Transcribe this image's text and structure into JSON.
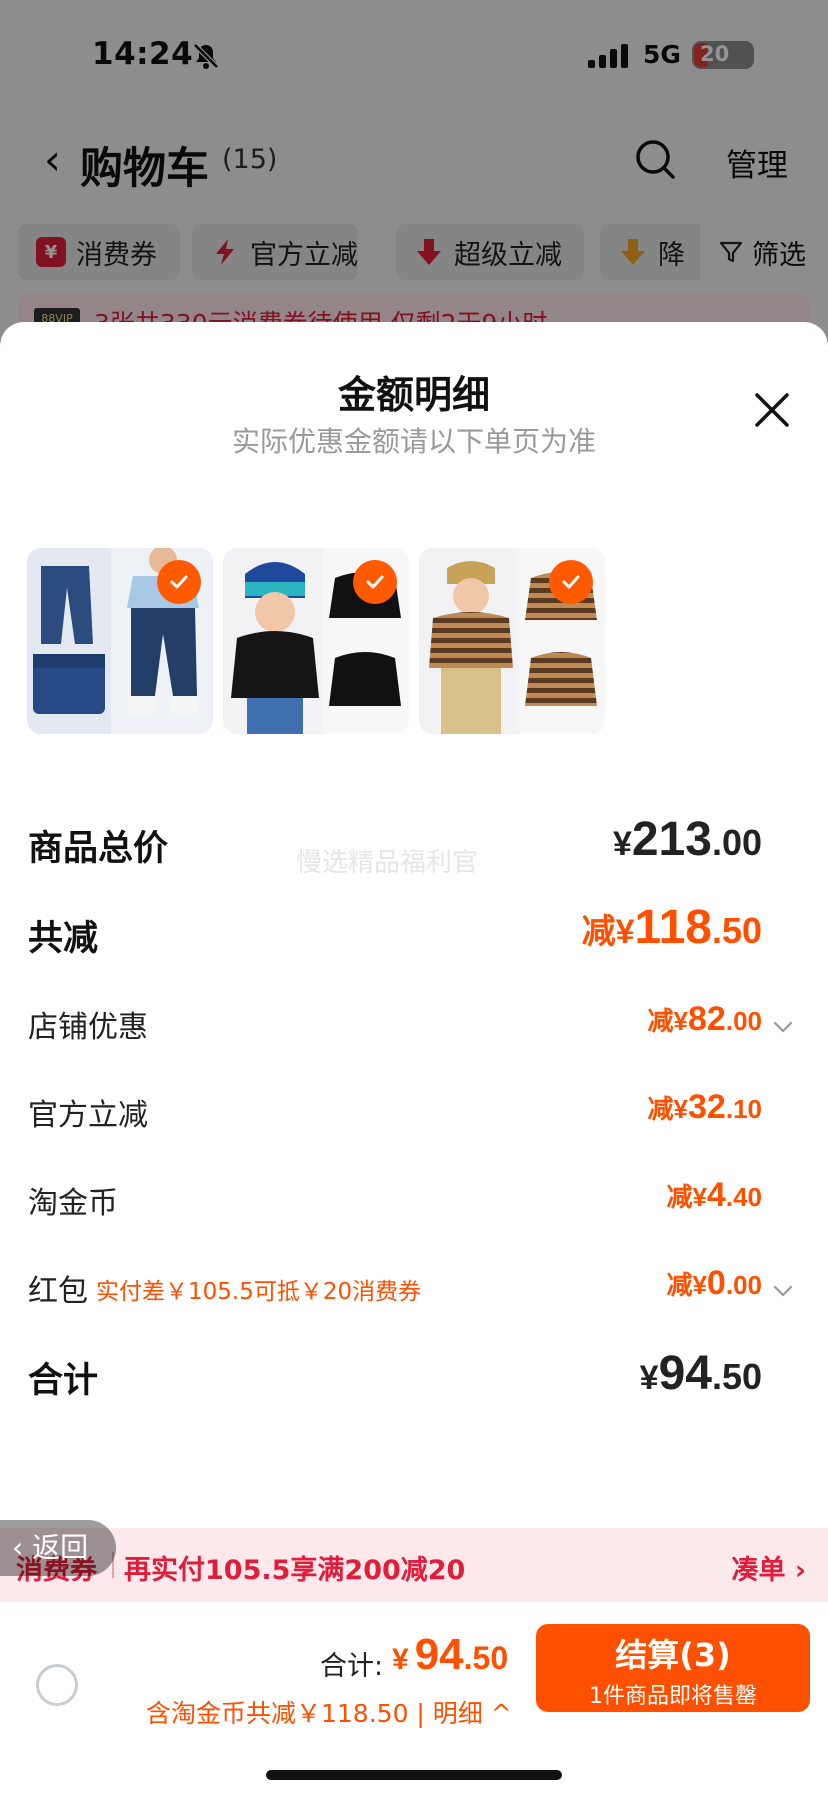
{
  "status_bar": {
    "time": "14:24",
    "network": "5G",
    "battery": "20"
  },
  "cart": {
    "title": "购物车",
    "count": "(15)",
    "manage": "管理"
  },
  "chips": [
    {
      "label": "消费券",
      "icon": "coupon-icon"
    },
    {
      "label": "官方立减",
      "icon": "lightning-icon"
    },
    {
      "label": "超级立减",
      "icon": "down-arrow-icon"
    },
    {
      "label": "降",
      "icon": "price-drop-icon"
    }
  ],
  "filter_label": "筛选",
  "banner": {
    "vip": "88VIP",
    "text": "3张共330元消费券待使用,仅剩2天9小时"
  },
  "sheet": {
    "title": "金额明细",
    "subtitle": "实际优惠金额请以下单页为准",
    "watermark": "慢选精品福利官"
  },
  "products": [
    {
      "icon": "product-jeans-image",
      "checked": true
    },
    {
      "icon": "product-black-turtleneck-image",
      "checked": true
    },
    {
      "icon": "product-striped-turtleneck-image",
      "checked": true
    }
  ],
  "rows": {
    "subtotal": {
      "label": "商品总价",
      "cur": "¥",
      "int": "213",
      "dec": ".00"
    },
    "total_discount": {
      "label": "共减",
      "cur": "减¥",
      "int": "118",
      "dec": ".50"
    },
    "store_discount": {
      "label": "店铺优惠",
      "cur": "减¥",
      "int": "82",
      "dec": ".00"
    },
    "official_discount": {
      "label": "官方立减",
      "cur": "减¥",
      "int": "32",
      "dec": ".10"
    },
    "taojinbi": {
      "label": "淘金币",
      "cur": "减¥",
      "int": "4",
      "dec": ".40"
    },
    "red_packet": {
      "label": "红包",
      "note": "实付差￥105.5可抵￥20消费券",
      "cur": "减¥",
      "int": "0",
      "dec": ".00"
    },
    "total": {
      "label": "合计",
      "cur": "¥",
      "int": "94",
      "dec": ".50"
    }
  },
  "promo": {
    "label": "消费券",
    "message": "再实付105.5享满200减20",
    "action": "凑单 ›"
  },
  "back_label": "返回",
  "footer": {
    "total_label": "合计:",
    "total_cur": "¥",
    "total_int": "94",
    "total_dec": ".50",
    "savings": "含淘金币共减￥118.50 | 明细 ^",
    "checkout_label": "结算(3)",
    "checkout_sub": "1件商品即将售罄"
  },
  "colors": {
    "accent": "#ff5000",
    "promo_red": "#e01e3c",
    "check": "#ff5a00"
  }
}
